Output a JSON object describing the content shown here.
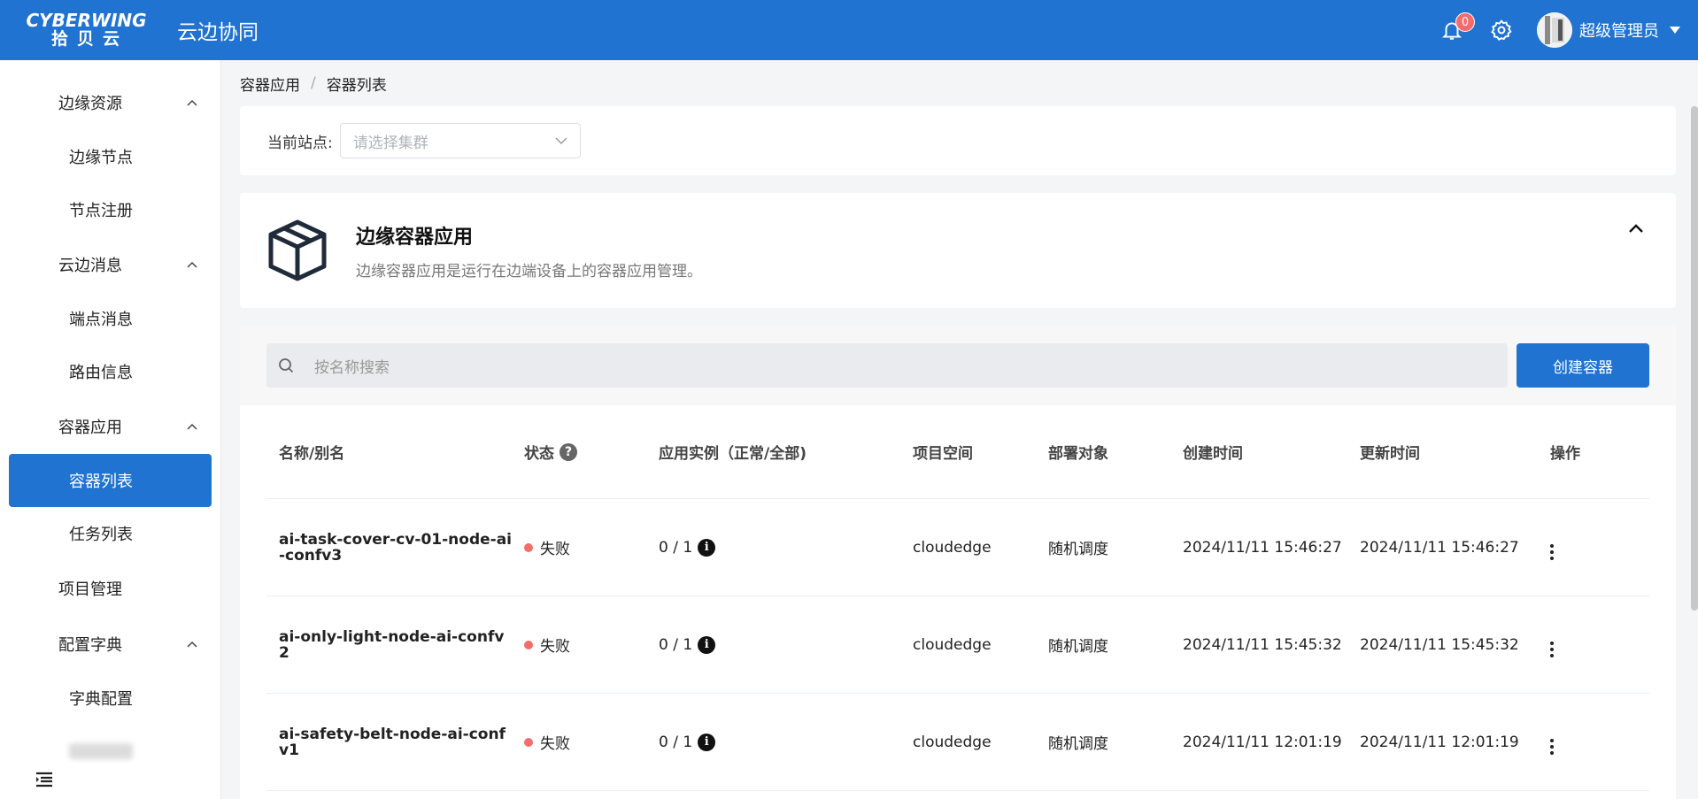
{
  "header": {
    "logo_top": "CYBERWING",
    "logo_bottom": "拾贝云",
    "title": "云边协同",
    "notification_count": "0",
    "user_name": "超级管理员"
  },
  "sidebar": {
    "groups": [
      {
        "label": "边缘资源",
        "items": [
          "边缘节点",
          "节点注册"
        ]
      },
      {
        "label": "云边消息",
        "items": [
          "端点消息",
          "路由信息"
        ]
      },
      {
        "label": "容器应用",
        "items": [
          "容器列表",
          "任务列表"
        ]
      },
      {
        "label": "项目管理"
      },
      {
        "label": "配置字典",
        "items": [
          "字典配置"
        ]
      }
    ]
  },
  "breadcrumb": {
    "first": "容器应用",
    "sep": "/",
    "second": "容器列表"
  },
  "station": {
    "label": "当前站点:",
    "placeholder": "请选择集群"
  },
  "intro": {
    "title": "边缘容器应用",
    "desc": "边缘容器应用是运行在边端设备上的容器应用管理。"
  },
  "search": {
    "placeholder": "按名称搜索",
    "create_label": "创建容器"
  },
  "table": {
    "headers": [
      "名称/别名",
      "状态",
      "应用实例（正常/全部)",
      "项目空间",
      "部署对象",
      "创建时间",
      "更新时间",
      "操作"
    ],
    "rows": [
      {
        "name": "ai-task-cover-cv-01-node-ai-confv3",
        "status": "失败",
        "instances": "0 / 1",
        "project": "cloudedge",
        "target": "随机调度",
        "created": "2024/11/11 15:46:27",
        "updated": "2024/11/11 15:46:27"
      },
      {
        "name": "ai-only-light-node-ai-confv2",
        "status": "失败",
        "instances": "0 / 1",
        "project": "cloudedge",
        "target": "随机调度",
        "created": "2024/11/11 15:45:32",
        "updated": "2024/11/11 15:45:32"
      },
      {
        "name": "ai-safety-belt-node-ai-confv1",
        "status": "失败",
        "instances": "0 / 1",
        "project": "cloudedge",
        "target": "随机调度",
        "created": "2024/11/11 12:01:19",
        "updated": "2024/11/11 12:01:19"
      }
    ]
  },
  "colors": {
    "primary": "#2073d1",
    "danger": "#f56c6c"
  }
}
